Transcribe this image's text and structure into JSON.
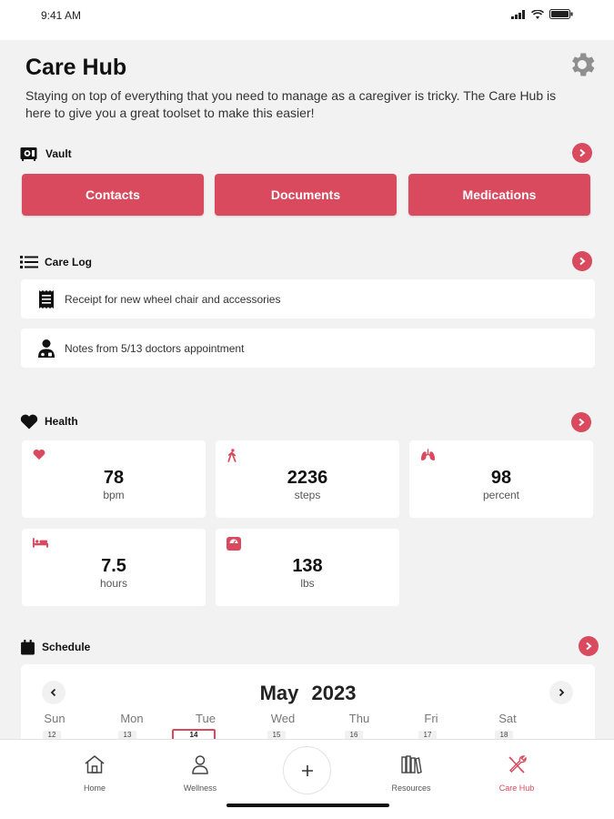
{
  "status_bar": {
    "time": "9:41 AM"
  },
  "header": {
    "title": "Care Hub",
    "intro": "Staying on top of everything that you need to manage as a caregiver is tricky. The Care Hub is here to give you a great toolset to make this easier!"
  },
  "vault": {
    "title": "Vault",
    "buttons": [
      "Contacts",
      "Documents",
      "Medications"
    ]
  },
  "care_log": {
    "title": "Care Log",
    "items": [
      {
        "icon": "receipt-icon",
        "text": "Receipt for new wheel chair and accessories"
      },
      {
        "icon": "doctor-icon",
        "text": "Notes from 5/13 doctors appointment"
      }
    ]
  },
  "health": {
    "title": "Health",
    "cards": [
      {
        "icon": "heart-icon",
        "value": "78",
        "unit": "bpm"
      },
      {
        "icon": "walking-icon",
        "value": "2236",
        "unit": "steps"
      },
      {
        "icon": "lungs-icon",
        "value": "98",
        "unit": "percent"
      },
      {
        "icon": "bed-icon",
        "value": "7.5",
        "unit": "hours"
      },
      {
        "icon": "scale-icon",
        "value": "138",
        "unit": "lbs"
      }
    ]
  },
  "schedule": {
    "title": "Schedule",
    "month": "May",
    "year": "2023",
    "weekdays": [
      "Sun",
      "Mon",
      "Tue",
      "Wed",
      "Thu",
      "Fri",
      "Sat"
    ],
    "days": [
      "12",
      "13",
      "14",
      "15",
      "16",
      "17",
      "18"
    ],
    "today": "14"
  },
  "tabs": [
    {
      "label": "Home",
      "icon": "home-icon"
    },
    {
      "label": "Wellness",
      "icon": "person-icon"
    },
    {
      "label": "Resources",
      "icon": "books-icon"
    },
    {
      "label": "Care Hub",
      "icon": "tools-icon",
      "active": true
    }
  ],
  "colors": {
    "accent": "#d94a5e",
    "background": "#f2f2f2",
    "card": "#ffffff"
  }
}
